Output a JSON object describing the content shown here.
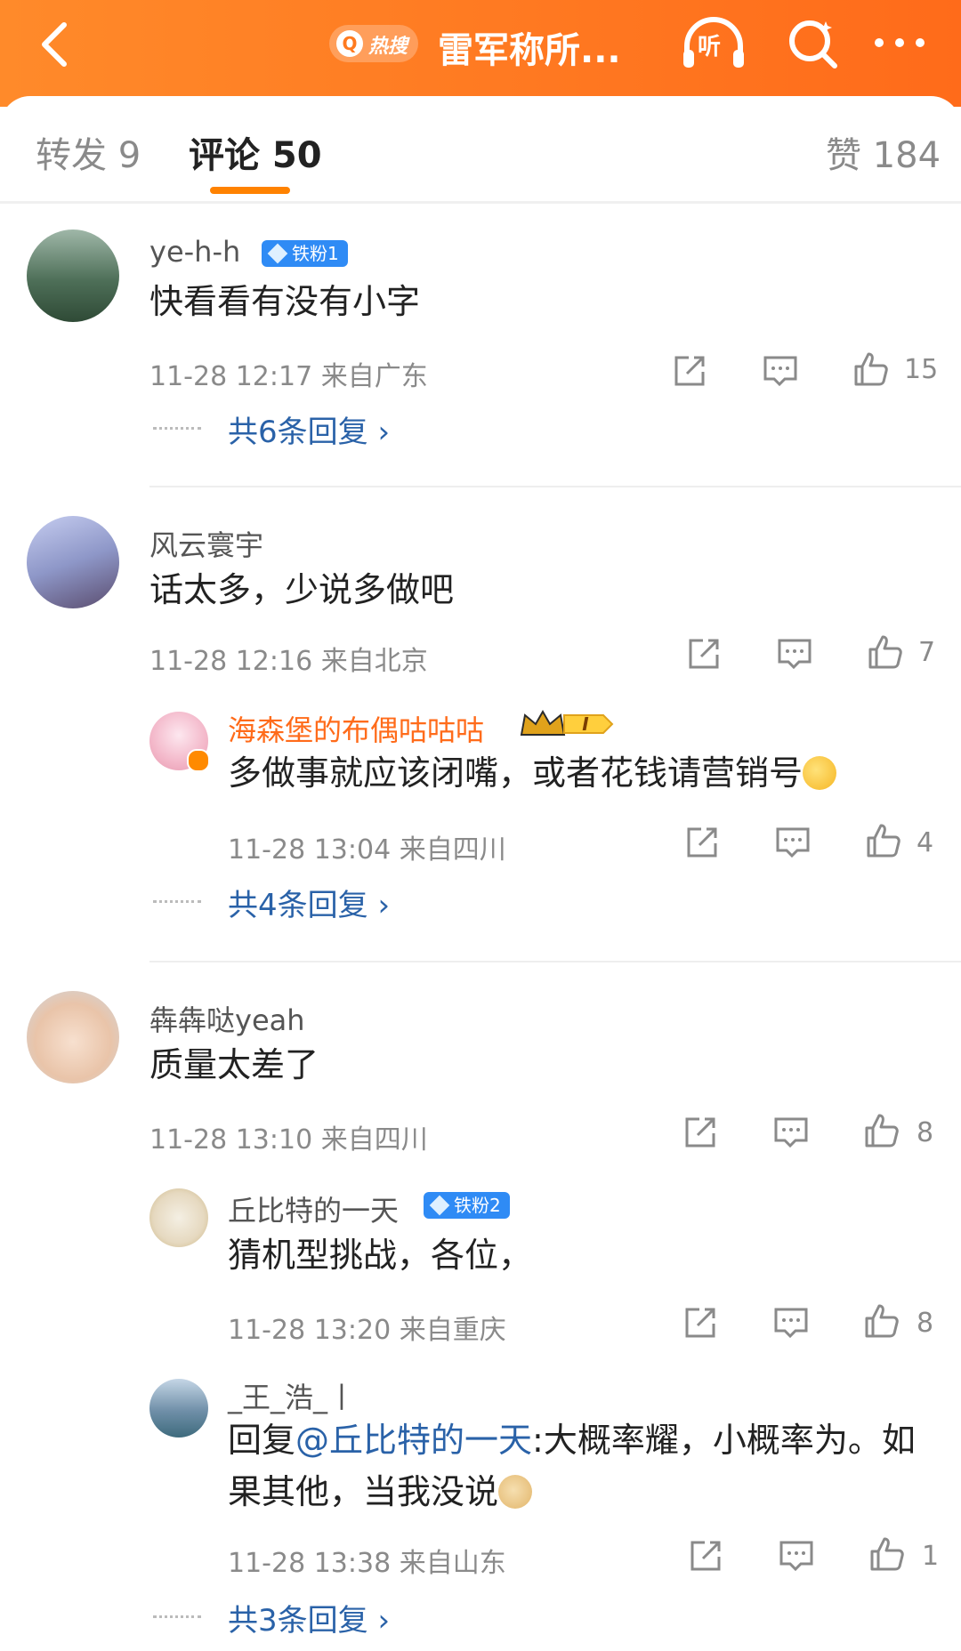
{
  "header": {
    "hot_label": "热搜",
    "title": "雷军称所...",
    "listen_label": "听",
    "colors": {
      "accent": "#ff7a1f",
      "link": "#2a62a8",
      "vip": "#ff6b1a"
    }
  },
  "tabs": {
    "repost": "转发 9",
    "comments": "评论 50",
    "likes": "赞 184"
  },
  "comments": [
    {
      "name": "ye-h-h",
      "badge": "铁粉1",
      "text": "快看看有没有小字",
      "meta": "11-28 12:17  来自广东",
      "likes": "15",
      "replies_label": "共6条回复 ›"
    },
    {
      "name": "风云寰宇",
      "text": "话太多，少说多做吧",
      "meta": "11-28 12:16  来自北京",
      "likes": "7",
      "reply": {
        "name": "海森堡的布偶咕咕咕",
        "level_badge": "I",
        "text": "多做事就应该闭嘴，或者花钱请营销号",
        "meta": "11-28 13:04  来自四川",
        "likes": "4"
      },
      "replies_label": "共4条回复 ›"
    },
    {
      "name": "犇犇哒yeah",
      "text": "质量太差了",
      "meta": "11-28 13:10  来自四川",
      "likes": "8",
      "reply1": {
        "name": "丘比特的一天",
        "badge": "铁粉2",
        "text": "猜机型挑战，各位，",
        "meta": "11-28 13:20  来自重庆",
        "likes": "8"
      },
      "reply2": {
        "name": "_王_浩_丨",
        "text_prefix": "回复",
        "mention": "@丘比特的一天",
        "text_line1_rest": ":大概率耀，小概率为。如",
        "text_line2": "果其他，当我没说",
        "meta": "11-28 13:38  来自山东",
        "likes": "1"
      },
      "replies_label": "共3条回复 ›"
    }
  ]
}
